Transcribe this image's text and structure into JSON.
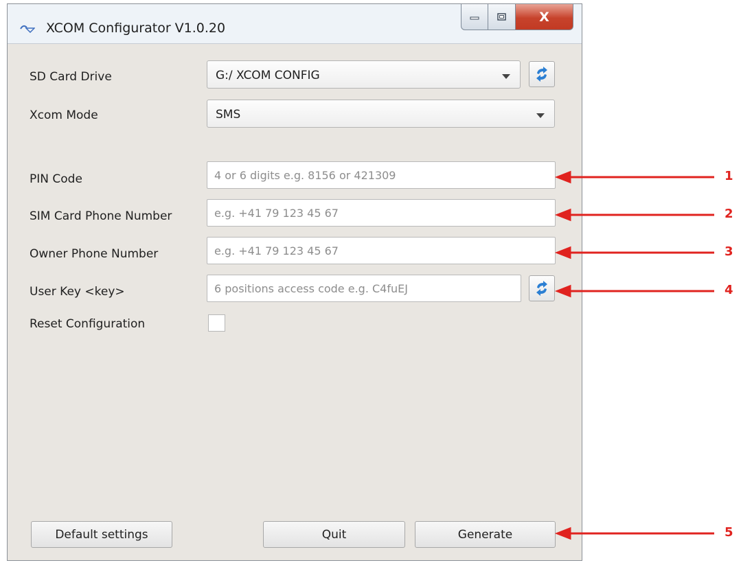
{
  "window": {
    "title": "XCOM Configurator V1.0.20",
    "close_label": "X"
  },
  "form": {
    "sd_card_drive": {
      "label": "SD Card Drive",
      "value": "G:/ XCOM CONFIG"
    },
    "xcom_mode": {
      "label": "Xcom Mode",
      "value": "SMS"
    },
    "pin_code": {
      "label": "PIN Code",
      "placeholder": "4 or 6 digits e.g. 8156 or 421309"
    },
    "sim_phone": {
      "label": "SIM Card Phone Number",
      "placeholder": "e.g. +41 79 123 45 67"
    },
    "owner_phone": {
      "label": "Owner Phone Number",
      "placeholder": "e.g. +41 79 123 45 67"
    },
    "user_key": {
      "label": "User Key <key>",
      "placeholder": "6 positions access code e.g. C4fuEJ"
    },
    "reset_config": {
      "label": "Reset Configuration",
      "checked": false
    }
  },
  "buttons": {
    "default_settings": "Default settings",
    "quit": "Quit",
    "generate": "Generate"
  },
  "annotations": [
    "1",
    "2",
    "3",
    "4",
    "5"
  ],
  "colors": {
    "annotation": "#e0231f",
    "refresh_icon": "#2b7fd3"
  },
  "icons": [
    "app-icon",
    "minimize-icon",
    "maximize-icon",
    "close-icon",
    "refresh-icon",
    "dropdown-arrow-icon"
  ]
}
